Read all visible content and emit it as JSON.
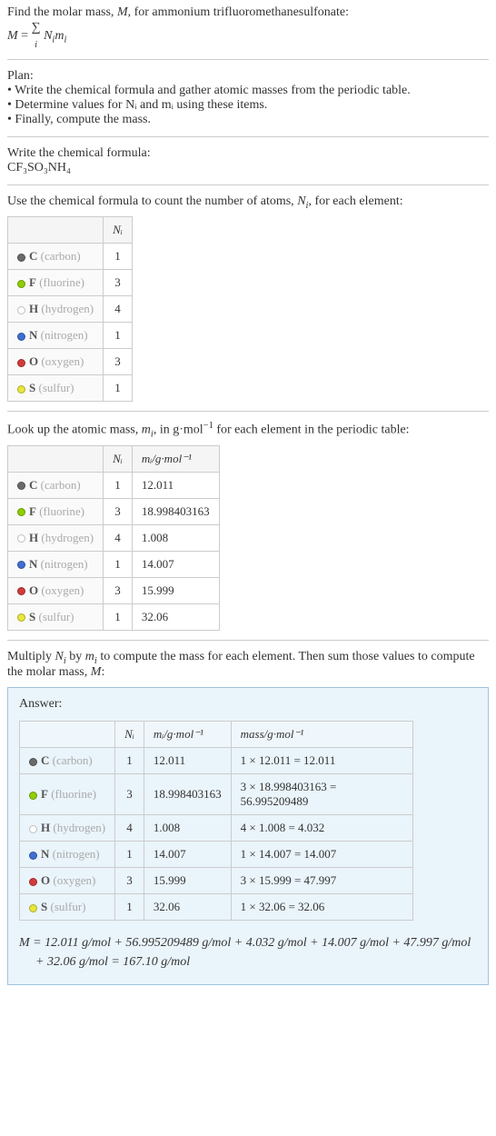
{
  "intro": {
    "line1_prefix": "Find the molar mass, ",
    "line1_var": "M",
    "line1_suffix": ", for ammonium trifluoromethanesulfonate:",
    "eq_lhs": "M",
    "eq_sum": "∑",
    "eq_sub": "i",
    "eq_rhs": " N",
    "eq_rhs_sub": "i",
    "eq_rhs2": "m",
    "eq_rhs2_sub": "i"
  },
  "plan": {
    "title": "Plan:",
    "items": [
      "Write the chemical formula and gather atomic masses from the periodic table.",
      "Determine values for Nᵢ and mᵢ using these items.",
      "Finally, compute the mass."
    ]
  },
  "formula": {
    "title": "Write the chemical formula:",
    "text": "CF₃SO₃NH₄"
  },
  "count": {
    "title_prefix": "Use the chemical formula to count the number of atoms, ",
    "title_var": "N",
    "title_var_sub": "i",
    "title_suffix": ", for each element:",
    "header_ni": "Nᵢ"
  },
  "elements": [
    {
      "sym": "C",
      "name": "carbon",
      "color": "#6a6a6a",
      "n": "1",
      "m": "12.011",
      "mass": "1 × 12.011 = 12.011"
    },
    {
      "sym": "F",
      "name": "fluorine",
      "color": "#8fce00",
      "n": "3",
      "m": "18.998403163",
      "mass": "3 × 18.998403163 = 56.995209489"
    },
    {
      "sym": "H",
      "name": "hydrogen",
      "color": "#ffffff",
      "n": "4",
      "m": "1.008",
      "mass": "4 × 1.008 = 4.032"
    },
    {
      "sym": "N",
      "name": "nitrogen",
      "color": "#3f6fd1",
      "n": "1",
      "m": "14.007",
      "mass": "1 × 14.007 = 14.007"
    },
    {
      "sym": "O",
      "name": "oxygen",
      "color": "#d23b3b",
      "n": "3",
      "m": "15.999",
      "mass": "3 × 15.999 = 47.997"
    },
    {
      "sym": "S",
      "name": "sulfur",
      "color": "#e7e73b",
      "n": "1",
      "m": "32.06",
      "mass": "1 × 32.06 = 32.06"
    }
  ],
  "lookup": {
    "title_prefix": "Look up the atomic mass, ",
    "title_var": "m",
    "title_var_sub": "i",
    "title_mid": ", in g·mol",
    "title_sup": "−1",
    "title_suffix": " for each element in the periodic table:",
    "header_ni": "Nᵢ",
    "header_mi": "mᵢ/g·mol⁻¹"
  },
  "multiply": {
    "text_prefix": "Multiply ",
    "n": "N",
    "nsub": "i",
    "by": " by ",
    "m": "m",
    "msub": "i",
    "text_suffix": " to compute the mass for each element. Then sum those values to compute the molar mass, ",
    "mvar": "M",
    "colon": ":"
  },
  "answer": {
    "label": "Answer:",
    "header_ni": "Nᵢ",
    "header_mi": "mᵢ/g·mol⁻¹",
    "header_mass": "mass/g·mol⁻¹",
    "final": "M = 12.011 g/mol + 56.995209489 g/mol + 4.032 g/mol + 14.007 g/mol + 47.997 g/mol + 32.06 g/mol = 167.10 g/mol"
  }
}
